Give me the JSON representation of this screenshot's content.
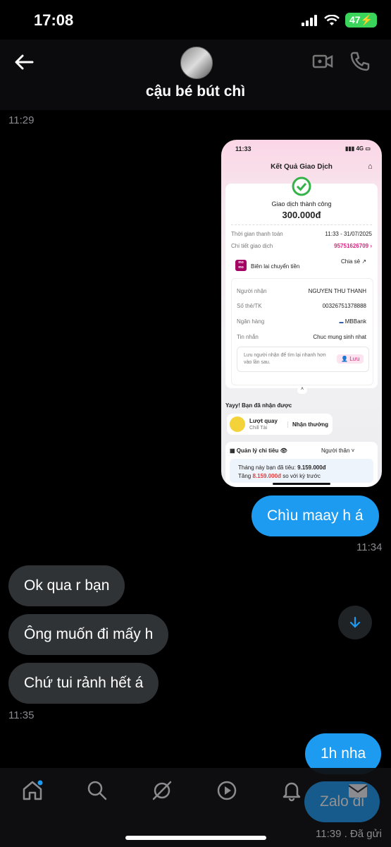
{
  "status_bar": {
    "time": "17:08",
    "battery": "47"
  },
  "header": {
    "contact_name": "cậu bé bút chì"
  },
  "messages": {
    "ts_top": "11:29",
    "screenshot": {
      "time": "11:33",
      "network": "4G",
      "page_title": "Kết Quả Giao Dịch",
      "success_text": "Giao dịch thành công",
      "amount": "300.000đ",
      "time_label": "Thời gian thanh toán",
      "time_value": "11:33 - 31/07/2025",
      "detail_label": "Chi tiết giao dịch",
      "detail_value": "95751626709",
      "momo_logo": "mo mo",
      "receipt_label": "Biên lai chuyển tiền",
      "share_label": "Chia sẻ",
      "receiver_label": "Người nhận",
      "receiver_value": "NGUYEN THU THANH",
      "account_label": "Số thẻ/TK",
      "account_value": "00326751378888",
      "bank_label": "Ngân hàng",
      "bank_value": "MBBank",
      "message_label": "Tin nhắn",
      "message_value": "Chuc mung sinh nhat",
      "save_hint": "Lưu người nhận để tìm lại nhanh hơn vào lần sau.",
      "save_button": "Lưu",
      "yay_text": "Yayy! Bạn đã nhận được",
      "spin_title": "Lượt quay",
      "spin_sub": "Chill Tài",
      "receive_button": "Nhận thưởng",
      "spending_title": "Quản lý chi tiêu",
      "relatives_label": "Người thân",
      "spent_line_prefix": "Tháng này bạn đã tiêu:",
      "spent_value": "9.159.000đ",
      "increase_prefix": "Tăng",
      "increase_value": "8.159.000đ",
      "increase_suffix": "so với kỳ trước"
    },
    "out_1": "Chìu maay h á",
    "ts_out_1": "11:34",
    "in_1": "Ok qua r bạn",
    "in_2": "Ông muốn đi mấy h",
    "in_3": "Chứ tui rảnh hết á",
    "ts_in": "11:35",
    "out_2": "1h nha",
    "out_3": "Zalo đi",
    "ts_out_3": "11:39",
    "sent_status": ". Đã gửi"
  },
  "colors": {
    "accent": "#1d9bf0",
    "incoming": "#2f3336",
    "momo_pink": "#d8257f"
  },
  "icons": [
    "back-arrow-icon",
    "video-call-icon",
    "phone-icon",
    "scroll-down-icon",
    "home-icon",
    "search-icon",
    "grok-icon",
    "video-icon",
    "bell-icon",
    "mail-icon"
  ]
}
